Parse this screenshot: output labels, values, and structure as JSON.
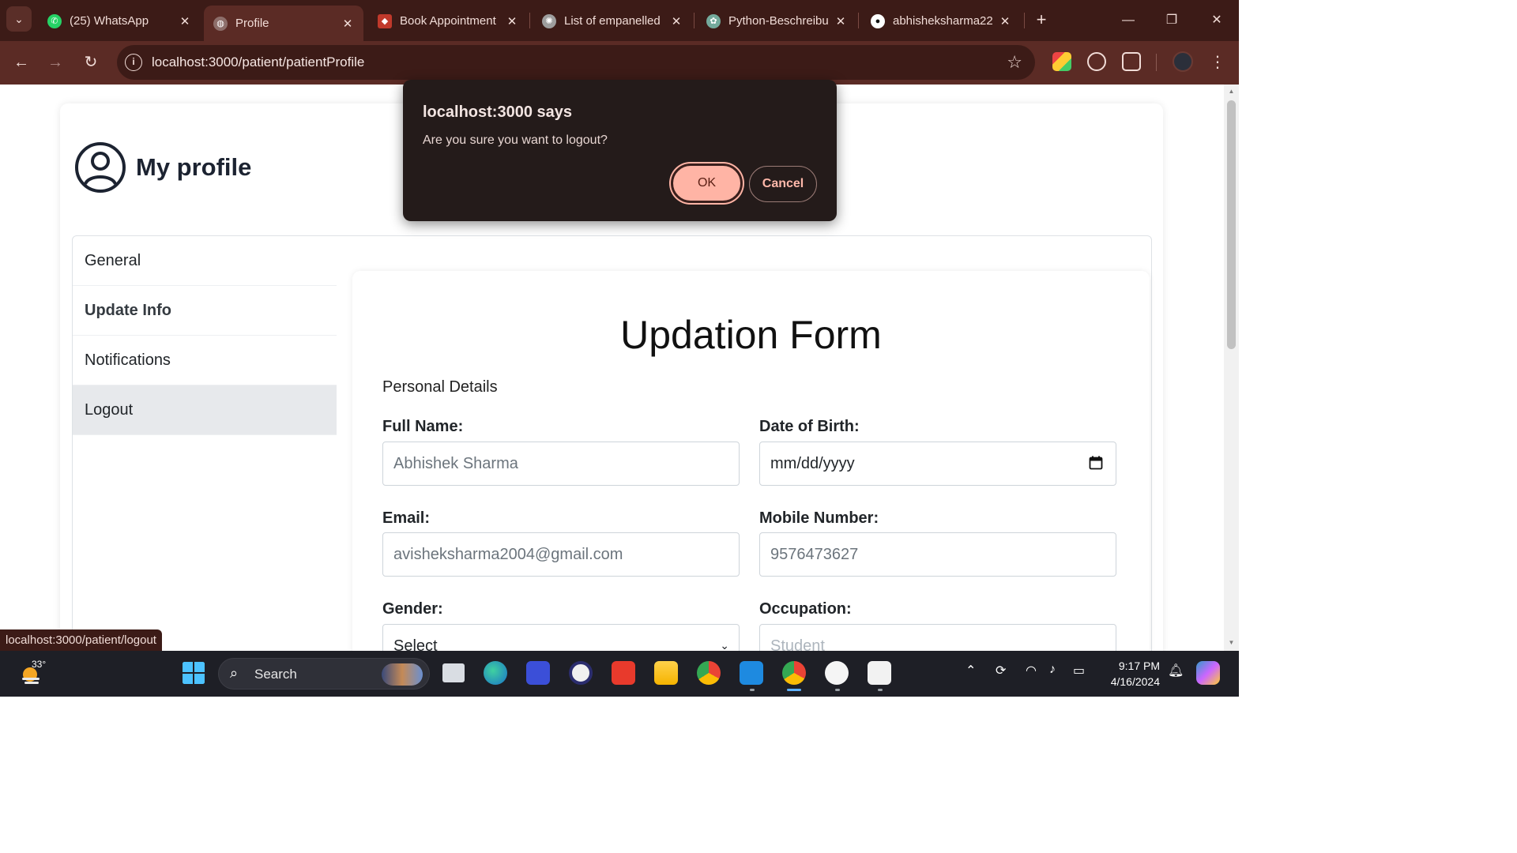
{
  "browser": {
    "tabs": [
      {
        "title": "(25) WhatsApp",
        "icon": "whatsapp-icon",
        "color": "#25d366"
      },
      {
        "title": "Profile",
        "icon": "globe-icon",
        "color": "#8d6e6a"
      },
      {
        "title": "Book Appointment",
        "icon": "book-icon",
        "color": "#c0392b"
      },
      {
        "title": "List of empanelled",
        "icon": "emblem-icon",
        "color": "#9e9e9e"
      },
      {
        "title": "Python-Beschreibu",
        "icon": "chatgpt-icon",
        "color": "#74aa9c"
      },
      {
        "title": "abhisheksharma22",
        "icon": "github-icon",
        "color": "#ffffff"
      }
    ],
    "url": "localhost:3000/patient/patientProfile",
    "status_url": "localhost:3000/patient/logout"
  },
  "page": {
    "profile_title": "My profile",
    "sidebar": [
      {
        "label": "General"
      },
      {
        "label": "Update Info"
      },
      {
        "label": "Notifications"
      },
      {
        "label": "Logout"
      }
    ],
    "form": {
      "title": "Updation Form",
      "section": "Personal Details",
      "fields": {
        "full_name": {
          "label": "Full Name:",
          "value": "Abhishek Sharma"
        },
        "dob": {
          "label": "Date of Birth:",
          "value": "mm/dd/yyyy"
        },
        "email": {
          "label": "Email:",
          "value": "avisheksharma2004@gmail.com"
        },
        "mobile": {
          "label": "Mobile Number:",
          "value": "9576473627"
        },
        "gender": {
          "label": "Gender:",
          "value": "Select"
        },
        "occupation": {
          "label": "Occupation:",
          "value": "Student"
        }
      }
    }
  },
  "dialog": {
    "title": "localhost:3000 says",
    "message": "Are you sure you want to logout?",
    "ok_label": "OK",
    "cancel_label": "Cancel"
  },
  "taskbar": {
    "temperature": "33°",
    "search_label": "Search",
    "time": "9:17 PM",
    "date": "4/16/2024"
  },
  "colors": {
    "chrome_dark": "#3c1b17",
    "chrome_toolbar": "#5b2b25",
    "dialog_bg": "#241b1a",
    "ok_button": "#ffb4a5",
    "taskbar": "#1e1f26"
  }
}
